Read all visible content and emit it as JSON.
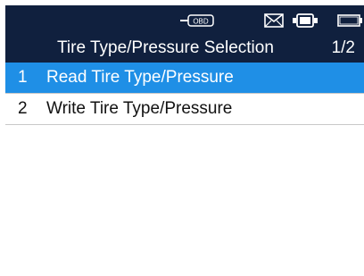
{
  "status": {
    "obd_label": "OBD",
    "icons": [
      "obd-connector-icon",
      "mail-icon",
      "vehicle-battery-icon",
      "battery-icon"
    ]
  },
  "header": {
    "title": "Tire Type/Pressure Selection",
    "page": "1/2"
  },
  "menu": {
    "items": [
      {
        "number": "1",
        "label": "Read Tire Type/Pressure",
        "selected": true
      },
      {
        "number": "2",
        "label": "Write Tire Type/Pressure",
        "selected": false
      }
    ]
  },
  "colors": {
    "header_bg": "#10203e",
    "selected_bg": "#1f8fe6",
    "text": "#111111"
  }
}
